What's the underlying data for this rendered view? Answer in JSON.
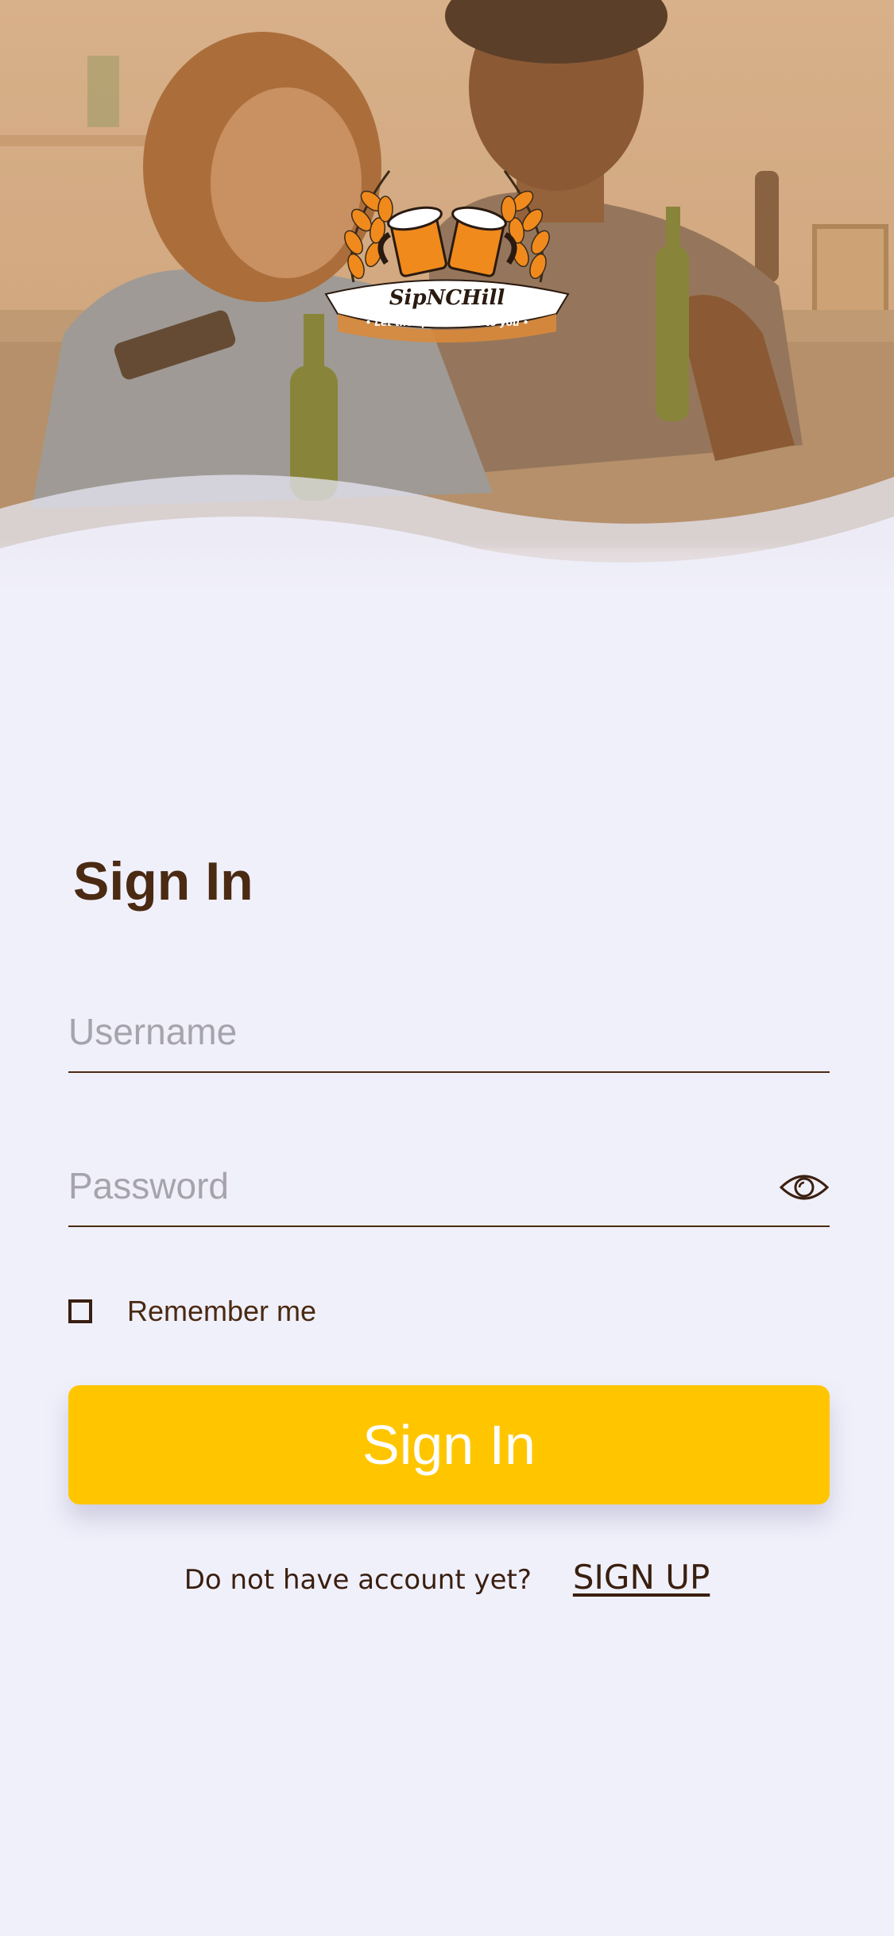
{
  "hero": {
    "image": "couple-drinking-beer-on-couch",
    "overlay_color": "#d9a066"
  },
  "logo": {
    "title": "SipNCHill",
    "tagline": "• Let the spirits come to you •",
    "icon": "beer-mugs-wheat-icon",
    "accent": "#f08a1c"
  },
  "form": {
    "title": "Sign In",
    "username_placeholder": "Username",
    "password_placeholder": "Password",
    "show_password_icon": "eye-icon",
    "remember_label": "Remember me",
    "remember_checked": false,
    "submit_label": "Sign In"
  },
  "footer": {
    "prompt": "Do not have account yet?",
    "signup_label": "SIGN UP"
  },
  "colors": {
    "background": "#f0f0fb",
    "primary_button": "#ffc600",
    "text_brown": "#4a2a12"
  }
}
